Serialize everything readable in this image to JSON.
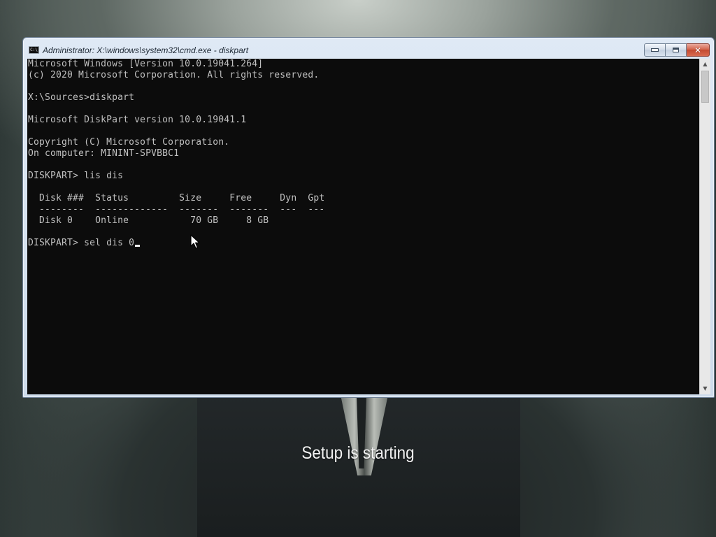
{
  "window": {
    "title": "Administrator: X:\\windows\\system32\\cmd.exe - diskpart",
    "icon_label": "C:\\",
    "icons": {
      "app": "cmd-icon",
      "minimize": "minimize-icon",
      "maximize": "maximize-icon",
      "close": "close-icon",
      "close_glyph": "✕"
    },
    "colors": {
      "console_background": "#0c0c0c",
      "console_text": "#c0c0c0",
      "close_button": "#c44a31"
    }
  },
  "console": {
    "lines": [
      "Microsoft Windows [Version 10.0.19041.264]",
      "(c) 2020 Microsoft Corporation. All rights reserved.",
      "",
      "X:\\Sources>diskpart",
      "",
      "Microsoft DiskPart version 10.0.19041.1",
      "",
      "Copyright (C) Microsoft Corporation.",
      "On computer: MININT-SPVBBC1",
      "",
      "DISKPART> lis dis",
      "",
      "  Disk ###  Status         Size     Free     Dyn  Gpt",
      "  --------  -------------  -------  -------  ---  ---",
      "  Disk 0    Online           70 GB     8 GB",
      ""
    ],
    "prompt": "DISKPART> ",
    "current_input": "sel dis 0"
  },
  "scrollbar": {
    "up_arrow": "▲",
    "down_arrow": "▼"
  },
  "background": {
    "status_text": "Setup is starting"
  }
}
